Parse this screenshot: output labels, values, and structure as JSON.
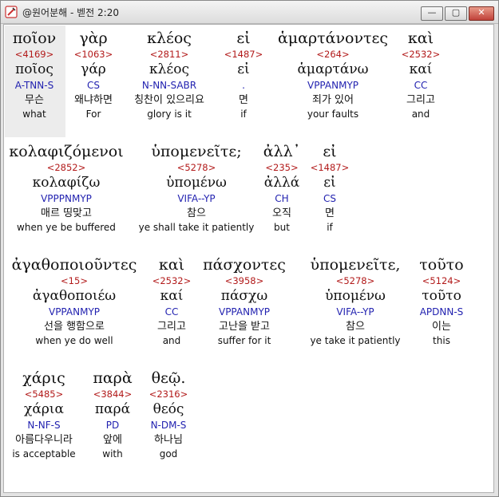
{
  "window": {
    "title": "@원어분해 - 벧전 2:20"
  },
  "buttons": {
    "minimize": "—",
    "maximize": "▢",
    "close": "✕"
  },
  "rows": [
    {
      "words": [
        {
          "greek": "ποῖον",
          "strong": "<4169>",
          "lemma": "ποῖος",
          "morph": "A-TNN-S",
          "korean": "무슨",
          "english": "what"
        },
        {
          "greek": "γὰρ",
          "strong": "<1063>",
          "lemma": "γάρ",
          "morph": "CS",
          "korean": "왜냐하면",
          "english": "For"
        },
        {
          "greek": "κλέος",
          "strong": "<2811>",
          "lemma": "κλέος",
          "morph": "N-NN-SABR",
          "korean": "칭찬이 있으리요",
          "english": "glory is it"
        },
        {
          "greek": "εἰ",
          "strong": "<1487>",
          "lemma": "εἰ",
          "morph": ".",
          "korean": "면",
          "english": "if"
        },
        {
          "greek": "ἁμαρτάνοντες",
          "strong": "<264>",
          "lemma": "ἁμαρτάνω",
          "morph": "VPPANMYP",
          "korean": "죄가 있어",
          "english": "your faults"
        },
        {
          "greek": "καὶ",
          "strong": "<2532>",
          "lemma": "καί",
          "morph": "CC",
          "korean": "그리고",
          "english": "and"
        }
      ]
    },
    {
      "words": [
        {
          "greek": "κολαφιζόμενοι",
          "strong": "<2852>",
          "lemma": "κολαφίζω",
          "morph": "VPPPNMYP",
          "korean": "매르 띵맞고",
          "english": "when ye be buffered"
        },
        {
          "greek": "ὑπομενεῖτε;",
          "strong": "<5278>",
          "lemma": "ὑπομένω",
          "morph": "VIFA--YP",
          "korean": "참으",
          "english": "ye shall take it patiently"
        },
        {
          "greek": "ἀλλ᾽",
          "strong": "<235>",
          "lemma": "ἀλλά",
          "morph": "CH",
          "korean": "오직",
          "english": "but"
        },
        {
          "greek": "εἰ",
          "strong": "<1487>",
          "lemma": "εἰ",
          "morph": "CS",
          "korean": "면",
          "english": "if"
        }
      ]
    },
    {
      "words": [
        {
          "greek": "ἀγαθοποιοῦντες",
          "strong": "<15>",
          "lemma": "ἀγαθοποιέω",
          "morph": "VPPANMYP",
          "korean": "선을 행함으로",
          "english": "when ye do well"
        },
        {
          "greek": "καὶ",
          "strong": "<2532>",
          "lemma": "καί",
          "morph": "CC",
          "korean": "그리고",
          "english": "and"
        },
        {
          "greek": "πάσχοντες",
          "strong": "<3958>",
          "lemma": "πάσχω",
          "morph": "VPPANMYP",
          "korean": "고난을 받고",
          "english": "suffer for it"
        },
        {
          "greek": "ὑπομενεῖτε,",
          "strong": "<5278>",
          "lemma": "ὑπομένω",
          "morph": "VIFA--YP",
          "korean": "참으",
          "english": "ye take it patiently"
        },
        {
          "greek": "τοῦτο",
          "strong": "<5124>",
          "lemma": "τοῦτο",
          "morph": "APDNN-S",
          "korean": "이는",
          "english": "this"
        }
      ]
    },
    {
      "words": [
        {
          "greek": "χάρις",
          "strong": "<5485>",
          "lemma": "χάρια",
          "morph": "N-NF-S",
          "korean": "아름다우니라",
          "english": "is acceptable"
        },
        {
          "greek": "παρὰ",
          "strong": "<3844>",
          "lemma": "παρά",
          "morph": "PD",
          "korean": "앞에",
          "english": "with"
        },
        {
          "greek": "θεῷ.",
          "strong": "<2316>",
          "lemma": "θεός",
          "morph": "N-DM-S",
          "korean": "하나님",
          "english": "god"
        }
      ]
    }
  ]
}
